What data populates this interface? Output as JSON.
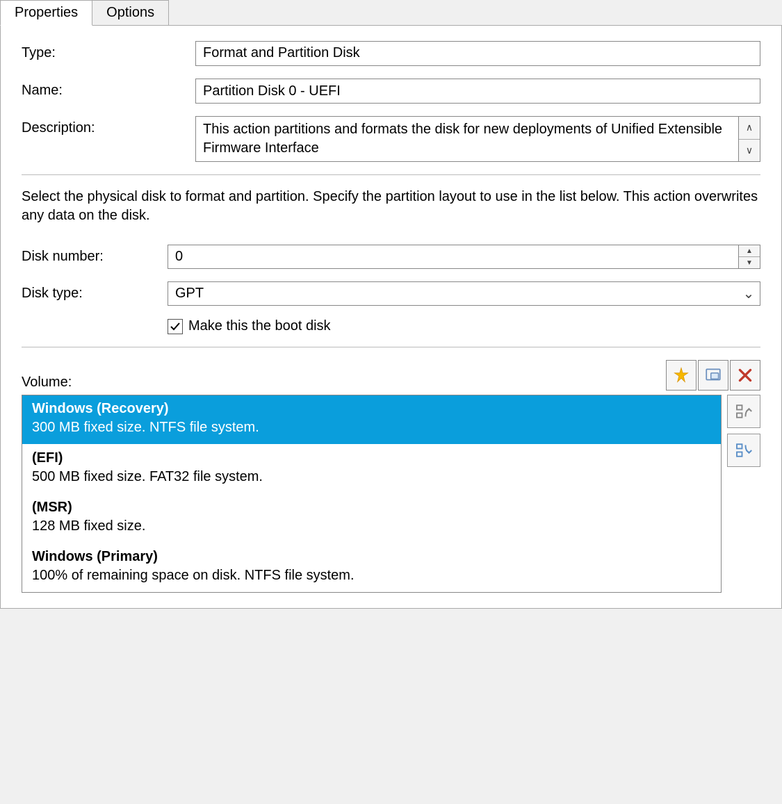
{
  "tabs": {
    "properties": "Properties",
    "options": "Options"
  },
  "labels": {
    "type": "Type:",
    "name": "Name:",
    "description": "Description:",
    "disk_number": "Disk number:",
    "disk_type": "Disk type:",
    "boot_disk": "Make this the boot disk",
    "volume": "Volume:"
  },
  "values": {
    "type": "Format and Partition Disk",
    "name": "Partition Disk 0 - UEFI",
    "description": "This action partitions and formats the disk for new deployments of Unified Extensible Firmware Interface",
    "disk_number": "0",
    "disk_type": "GPT",
    "boot_disk_checked": true
  },
  "instruction": "Select the physical disk to format and partition. Specify the partition layout to use in the list below. This action overwrites any data on the disk.",
  "volumes": [
    {
      "title": "Windows (Recovery)",
      "desc": "300 MB fixed size. NTFS file system.",
      "selected": true
    },
    {
      "title": "(EFI)",
      "desc": "500 MB fixed size. FAT32 file system.",
      "selected": false
    },
    {
      "title": "(MSR)",
      "desc": "128 MB fixed size.",
      "selected": false
    },
    {
      "title": "Windows (Primary)",
      "desc": "100% of remaining space on disk. NTFS file system.",
      "selected": false
    }
  ]
}
